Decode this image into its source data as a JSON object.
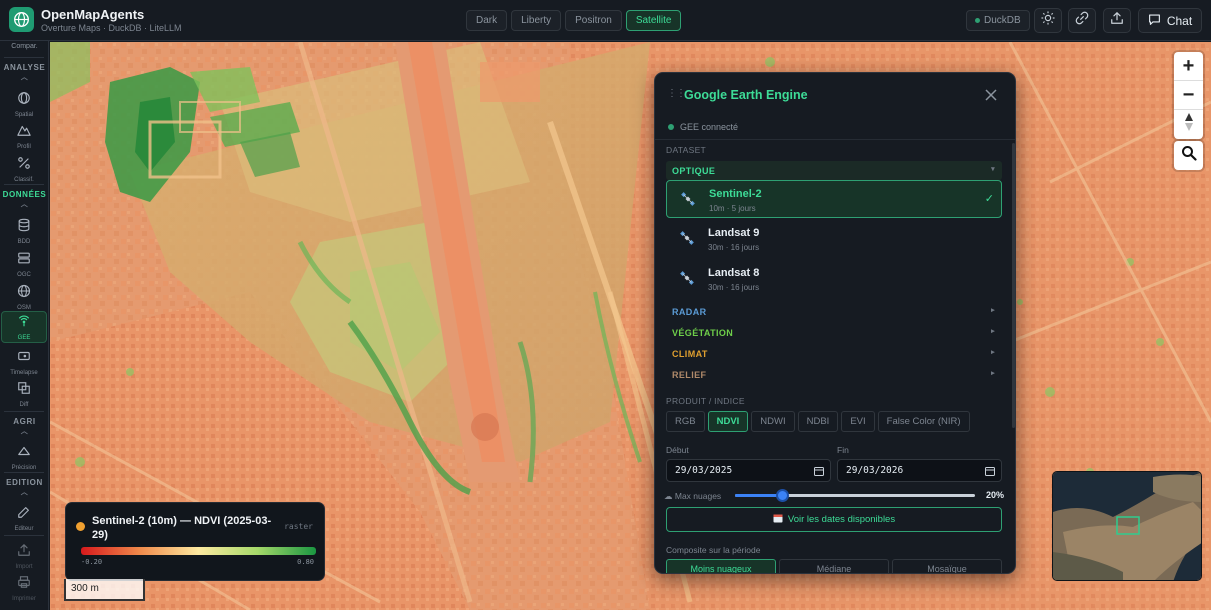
{
  "app": {
    "title": "OpenMapAgents",
    "subtitle": "Overture Maps · DuckDB · LiteLLM"
  },
  "basemap_styles": [
    {
      "label": "Dark",
      "active": false
    },
    {
      "label": "Liberty",
      "active": false
    },
    {
      "label": "Positron",
      "active": false
    },
    {
      "label": "Satellite",
      "active": true
    }
  ],
  "header": {
    "duckdb_label": "DuckDB",
    "icons": [
      "sun-icon",
      "link-icon",
      "upload-icon"
    ],
    "chat_label": "Chat"
  },
  "sidebar": {
    "top_item": "Compar.",
    "sections": [
      {
        "title": "ANALYSE",
        "items": [
          "Spatial",
          "Profil",
          "Classif."
        ]
      },
      {
        "title": "DONNÉES",
        "items": [
          "BDD",
          "OGC",
          "OSM",
          "GEE",
          "Timelapse",
          "Diff"
        ]
      },
      {
        "title": "AGRI",
        "items": [
          "Précision"
        ]
      },
      {
        "title": "EDITION",
        "items": [
          "Editeur"
        ]
      }
    ],
    "bottom_items": [
      "Import",
      "Imprimer"
    ],
    "active_item": "GEE"
  },
  "gee_panel": {
    "title": "Google Earth Engine",
    "status": "GEE connecté",
    "dataset_caption": "DATASET",
    "categories": [
      {
        "label": "OPTIQUE",
        "color": "#3ddc97",
        "open": true
      },
      {
        "label": "RADAR",
        "color": "#5b9bd5",
        "open": false
      },
      {
        "label": "VÉGÉTATION",
        "color": "#6fcf4a",
        "open": false
      },
      {
        "label": "CLIMAT",
        "color": "#e0a030",
        "open": false
      },
      {
        "label": "RELIEF",
        "color": "#b08a6a",
        "open": false
      }
    ],
    "datasets": [
      {
        "name": "Sentinel-2",
        "meta": "10m · 5 jours",
        "selected": true,
        "check": "✓"
      },
      {
        "name": "Landsat 9",
        "meta": "30m · 16 jours",
        "selected": false,
        "check": ""
      },
      {
        "name": "Landsat 8",
        "meta": "30m · 16 jours",
        "selected": false,
        "check": ""
      }
    ],
    "product_caption": "PRODUIT / INDICE",
    "products": [
      "RGB",
      "NDVI",
      "NDWI",
      "NDBI",
      "EVI",
      "False Color (NIR)"
    ],
    "selected_product": "NDVI",
    "start_label": "Début",
    "start_date": "29/03/2025",
    "end_label": "Fin",
    "end_date": "29/03/2026",
    "cloud_label": "Max nuages",
    "cloud_value": "20%",
    "cloud_fraction": 0.2,
    "dates_button": "Voir les dates disponibles",
    "composite_label": "Composite sur la période",
    "composites": [
      "Moins nuageux",
      "Médiane",
      "Mosaïque"
    ],
    "selected_composite": "Moins nuageux"
  },
  "legend": {
    "title": "Sentinel-2 (10m) — NDVI (2025-03-29)",
    "tag": "raster",
    "min": "-0.20",
    "max": "0.80",
    "colors": [
      "#d7191c",
      "#f08a4b",
      "#fde9a0",
      "#a6d96a",
      "#1a9641"
    ]
  },
  "scale_bar": "300 m",
  "map_controls": {
    "zoom_in": "+",
    "zoom_out": "−"
  }
}
